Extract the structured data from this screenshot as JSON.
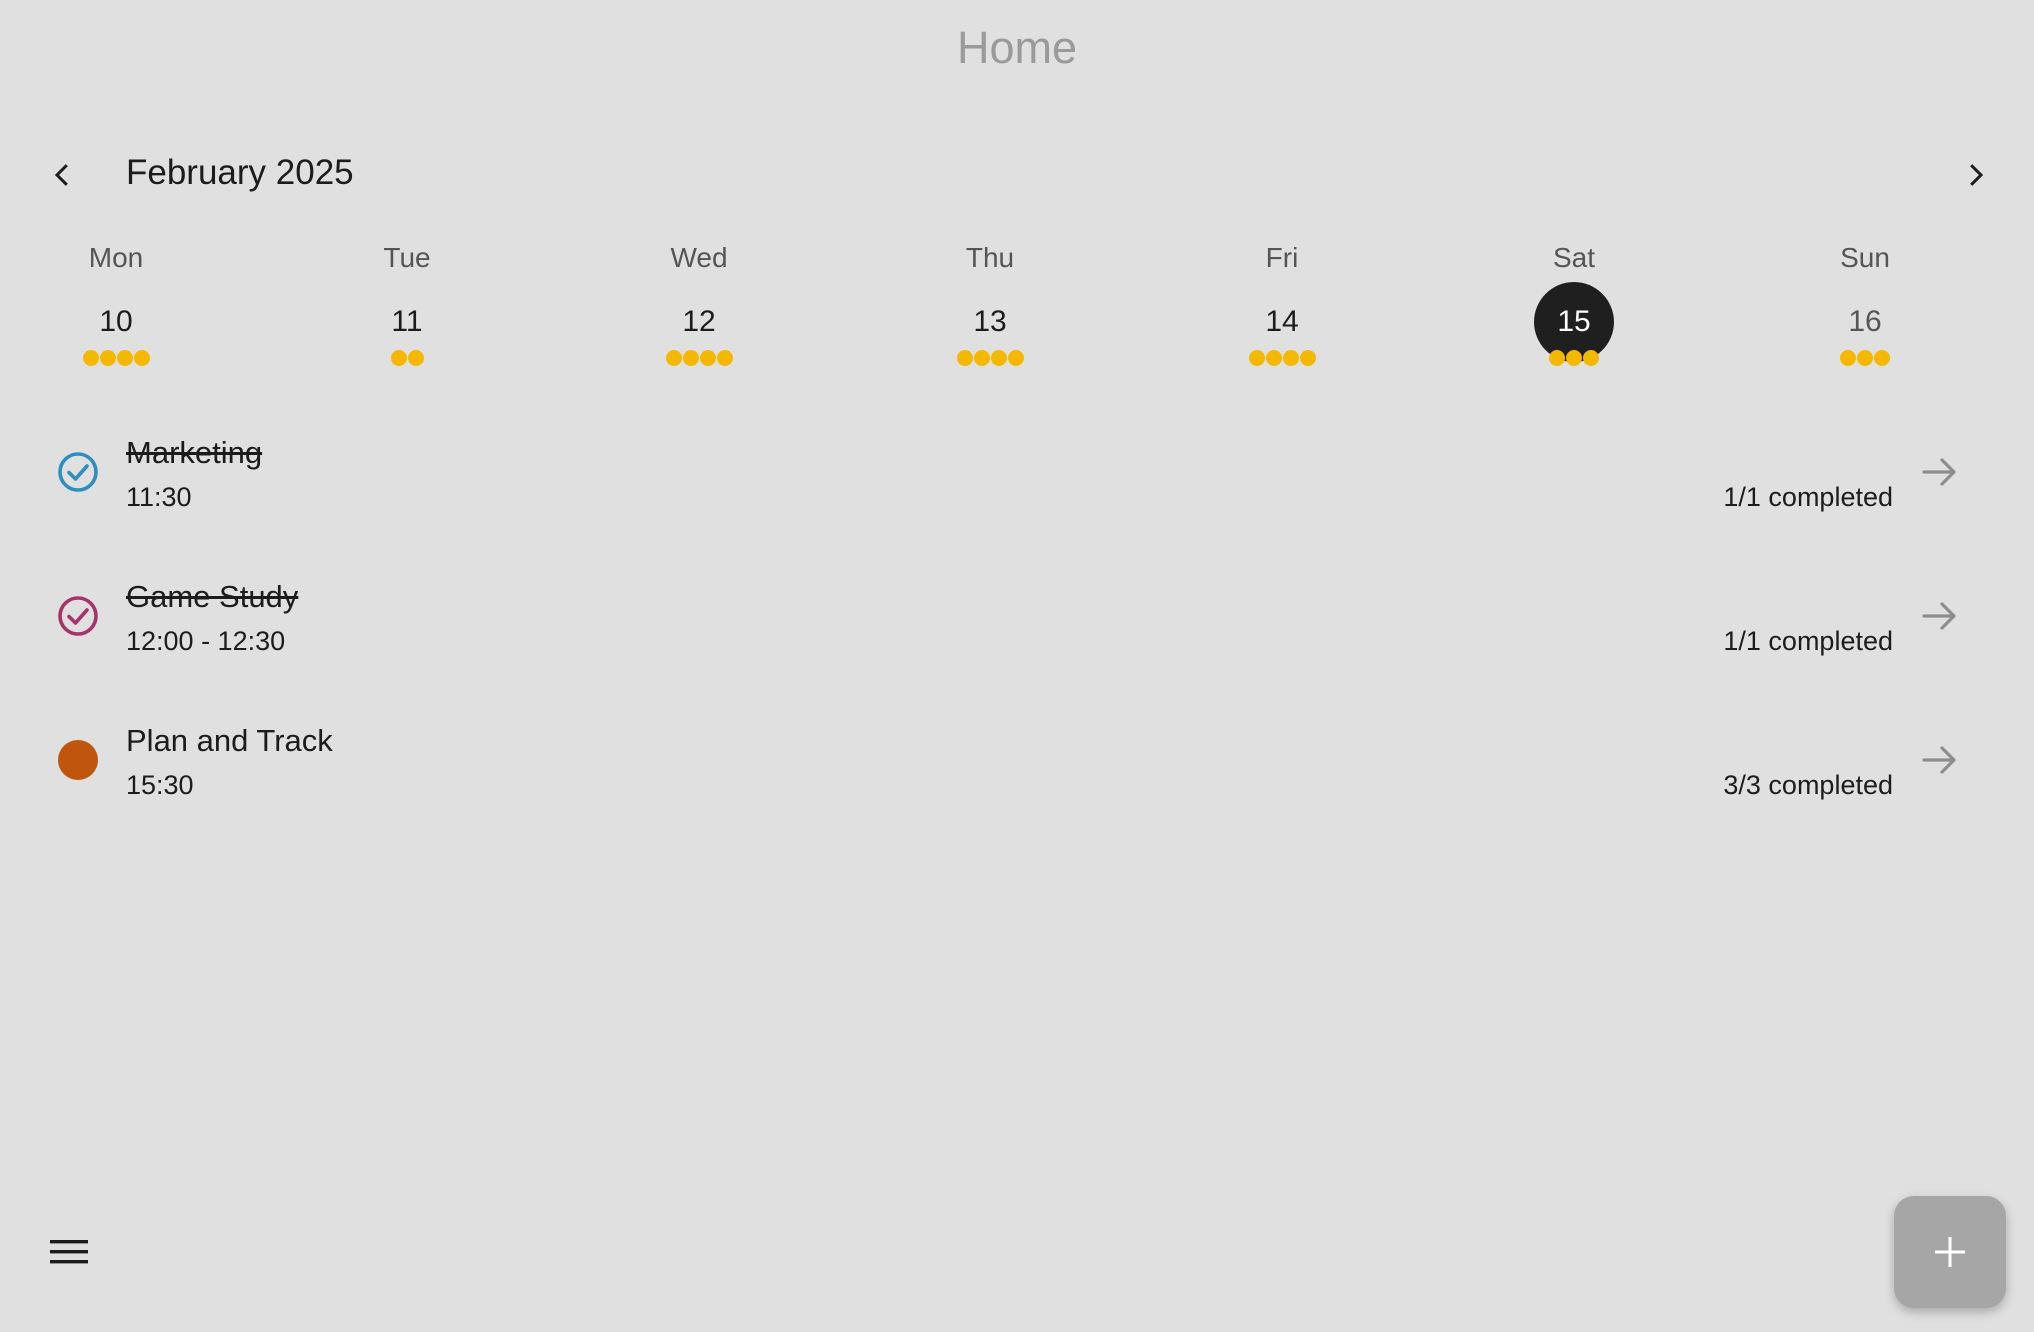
{
  "header": {
    "title": "Home"
  },
  "calendar": {
    "month_label": "February 2025",
    "prev_icon": "chevron-left-icon",
    "next_icon": "chevron-right-icon",
    "dot_color": "#f5b800",
    "days": [
      {
        "dow": "Mon",
        "date": "10",
        "dots": 4,
        "selected": false
      },
      {
        "dow": "Tue",
        "date": "11",
        "dots": 2,
        "selected": false
      },
      {
        "dow": "Wed",
        "date": "12",
        "dots": 4,
        "selected": false
      },
      {
        "dow": "Thu",
        "date": "13",
        "dots": 4,
        "selected": false
      },
      {
        "dow": "Fri",
        "date": "14",
        "dots": 4,
        "selected": false
      },
      {
        "dow": "Sat",
        "date": "15",
        "dots": 3,
        "selected": true
      },
      {
        "dow": "Sun",
        "date": "16",
        "dots": 3,
        "selected": false
      }
    ]
  },
  "events": [
    {
      "title": "Marketing",
      "time": "11:30",
      "progress": "1/1 completed",
      "completed": true,
      "color": "#2b8fbf",
      "status_icon": "check-circle-icon",
      "arrow_icon": "arrow-right-icon"
    },
    {
      "title": "Game Study",
      "time": "12:00 - 12:30",
      "progress": "1/1 completed",
      "completed": true,
      "color": "#a8336b",
      "status_icon": "check-circle-icon",
      "arrow_icon": "arrow-right-icon"
    },
    {
      "title": "Plan and Track",
      "time": "15:30",
      "progress": "3/3 completed",
      "completed": false,
      "color": "#c0560e",
      "status_icon": "filled-circle-icon",
      "arrow_icon": "arrow-right-icon"
    }
  ],
  "bottom": {
    "menu_icon": "hamburger-menu-icon",
    "fab_icon": "plus-icon"
  }
}
